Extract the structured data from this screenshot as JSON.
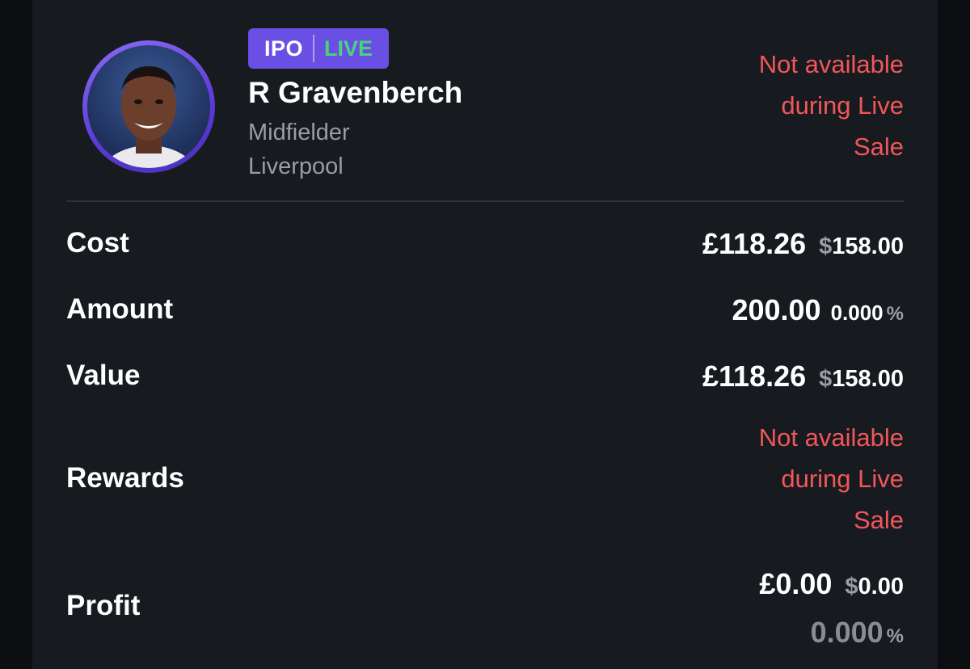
{
  "player": {
    "badge_ipo": "IPO",
    "badge_live": "LIVE",
    "name": "R Gravenberch",
    "position": "Midfielder",
    "club": "Liverpool",
    "header_notice": [
      "Not available",
      "during Live",
      "Sale"
    ]
  },
  "stats": {
    "cost": {
      "label": "Cost",
      "primary": "£118.26",
      "secondary_symbol": "$",
      "secondary_value": "158.00"
    },
    "amount": {
      "label": "Amount",
      "primary": "200.00",
      "percent_value": "0.000",
      "percent_symbol": "%"
    },
    "value": {
      "label": "Value",
      "primary": "£118.26",
      "secondary_symbol": "$",
      "secondary_value": "158.00"
    },
    "rewards": {
      "label": "Rewards",
      "notice": [
        "Not available",
        "during Live",
        "Sale"
      ]
    },
    "profit": {
      "label": "Profit",
      "primary": "£0.00",
      "secondary_symbol": "$",
      "secondary_value": "0.00",
      "percent_value": "0.000",
      "percent_symbol": "%"
    }
  },
  "colors": {
    "background": "#171a1f",
    "accent_badge": "#6a4fe4",
    "live_green": "#49d47a",
    "notice_red": "#f0575a"
  }
}
